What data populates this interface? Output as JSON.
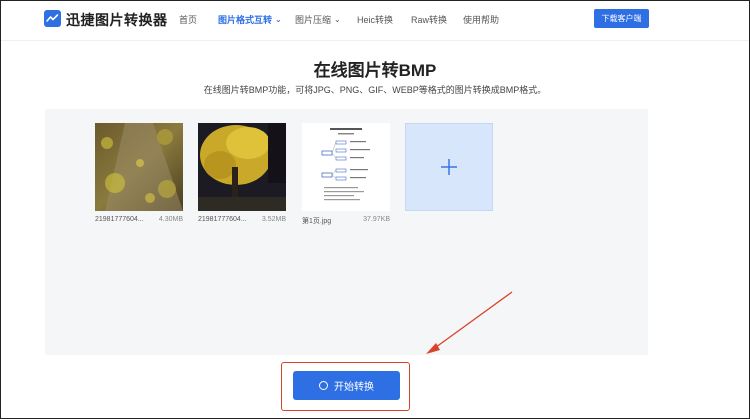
{
  "header": {
    "logo_text": "迅捷图片转换器",
    "nav": [
      {
        "label": "首页",
        "active": false,
        "has_dropdown": false
      },
      {
        "label": "图片格式互转",
        "active": true,
        "has_dropdown": true
      },
      {
        "label": "图片压缩",
        "active": false,
        "has_dropdown": true
      },
      {
        "label": "Heic转换",
        "active": false,
        "has_dropdown": false
      },
      {
        "label": "Raw转换",
        "active": false,
        "has_dropdown": false
      },
      {
        "label": "使用帮助",
        "active": false,
        "has_dropdown": false
      }
    ],
    "download_label": "下载客户端"
  },
  "main": {
    "title": "在线图片转BMP",
    "subtitle": "在线图片转BMP功能，可将JPG、PNG、GIF、WEBP等格式的图片转换成BMP格式。",
    "files": [
      {
        "name": "21981777604...",
        "size": "4.30MB"
      },
      {
        "name": "21981777604...",
        "size": "3.52MB"
      },
      {
        "name": "第1页.jpg",
        "size": "37.97KB"
      }
    ],
    "add_icon": "plus-icon",
    "start_label": "开始转换"
  },
  "colors": {
    "accent": "#2f6fe4",
    "highlight": "#d9432a",
    "upload_bg": "#f5f6f8",
    "add_tile_bg": "#d7e6fb"
  }
}
